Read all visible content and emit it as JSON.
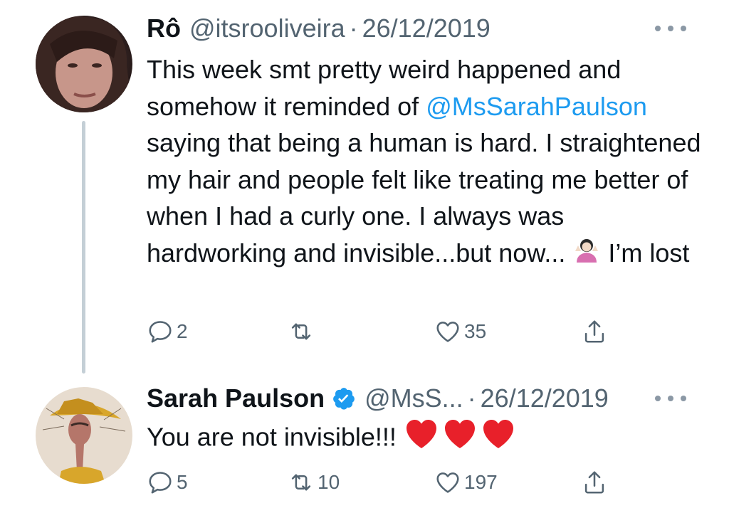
{
  "tweet1": {
    "name": "Rô",
    "handle": "@itsrooliveira",
    "separator": "·",
    "date": "26/12/2019",
    "text_before": "This week smt pretty weird happened and somehow it reminded of",
    "mention": "@MsSarahPaulson",
    "text_after": "saying that being a human is hard. I straightened my hair and people felt like treating me better of when I had a curly one. I always was hardworking and invisible...but now...",
    "text_end": "I’m lost",
    "emoji": "person-shrugging-icon",
    "replies": "2",
    "retweets": "",
    "likes": "35"
  },
  "tweet2": {
    "name": "Sarah Paulson",
    "handle": "@MsS...",
    "separator": "·",
    "date": "26/12/2019",
    "text": "You are not invisible!!!",
    "emoji": "red-heart-icon",
    "replies": "5",
    "retweets": "10",
    "likes": "197"
  },
  "colors": {
    "text": "#0f1419",
    "secondary": "#536471",
    "link": "#1d9bf0",
    "thread_line": "#c4cfd6",
    "heart": "#e8202a"
  }
}
